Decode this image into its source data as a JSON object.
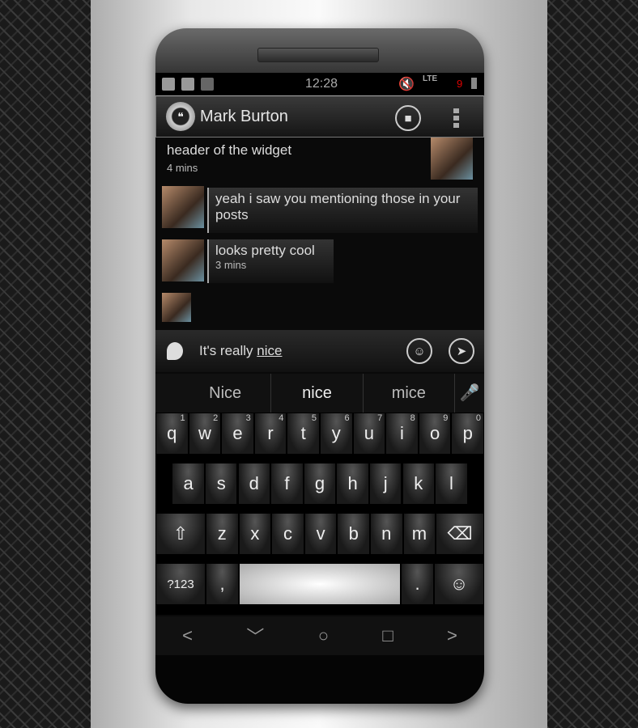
{
  "status": {
    "time": "12:28",
    "network": "LTE",
    "battery_badge": "9"
  },
  "header": {
    "contact": "Mark Burton",
    "icons": [
      "hangouts-logo",
      "video-call-icon",
      "overflow-menu-icon"
    ]
  },
  "messages": [
    {
      "text": "header of the widget",
      "time": "4 mins",
      "side": "right"
    },
    {
      "text": "yeah i saw you mentioning those in your posts",
      "time": "",
      "side": "left"
    },
    {
      "text": "looks pretty cool",
      "time": "3 mins",
      "side": "left"
    }
  ],
  "compose": {
    "text_prefix": "It's really ",
    "text_underlined": "nice"
  },
  "suggestions": [
    "Nice",
    "nice",
    "mice"
  ],
  "keyboard": {
    "row1": [
      "q",
      "w",
      "e",
      "r",
      "t",
      "y",
      "u",
      "i",
      "o",
      "p"
    ],
    "digits": [
      "1",
      "2",
      "3",
      "4",
      "5",
      "6",
      "7",
      "8",
      "9",
      "0"
    ],
    "row2": [
      "a",
      "s",
      "d",
      "f",
      "g",
      "h",
      "j",
      "k",
      "l"
    ],
    "row3": [
      "z",
      "x",
      "c",
      "v",
      "b",
      "n",
      "m"
    ],
    "symbols_label": "?123",
    "comma": ",",
    "period": "."
  },
  "nav": {
    "back": "<",
    "home": "○",
    "recents": "□",
    "forward": ">"
  }
}
